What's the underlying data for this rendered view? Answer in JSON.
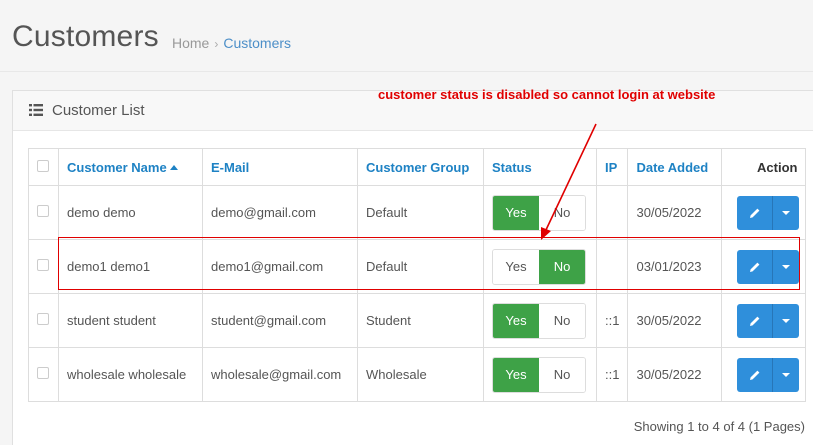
{
  "header": {
    "title": "Customers",
    "breadcrumb": {
      "home": "Home",
      "sep": "›",
      "current": "Customers"
    }
  },
  "panel": {
    "title": "Customer List"
  },
  "annotation": {
    "text": "customer status is disabled so cannot login at website"
  },
  "colors": {
    "accent": "#1e82c4",
    "enabled": "#3ea247",
    "annotation": "#e00000",
    "button": "#2f8fdb"
  },
  "table": {
    "headers": {
      "name": "Customer Name",
      "email": "E-Mail",
      "group": "Customer Group",
      "status": "Status",
      "ip": "IP",
      "date": "Date Added",
      "action": "Action"
    },
    "rows": [
      {
        "name": "demo demo",
        "email": "demo@gmail.com",
        "group": "Default",
        "yes": "Yes",
        "no": "No",
        "status": "yes",
        "ip": "",
        "date": "30/05/2022"
      },
      {
        "name": "demo1 demo1",
        "email": "demo1@gmail.com",
        "group": "Default",
        "yes": "Yes",
        "no": "No",
        "status": "no",
        "ip": "",
        "date": "03/01/2023"
      },
      {
        "name": "student student",
        "email": "student@gmail.com",
        "group": "Student",
        "yes": "Yes",
        "no": "No",
        "status": "yes",
        "ip": "::1",
        "date": "30/05/2022"
      },
      {
        "name": "wholesale wholesale",
        "email": "wholesale@gmail.com",
        "group": "Wholesale",
        "yes": "Yes",
        "no": "No",
        "status": "yes",
        "ip": "::1",
        "date": "30/05/2022"
      }
    ]
  },
  "footer": {
    "pagination": "Showing 1 to 4 of 4 (1 Pages)"
  }
}
